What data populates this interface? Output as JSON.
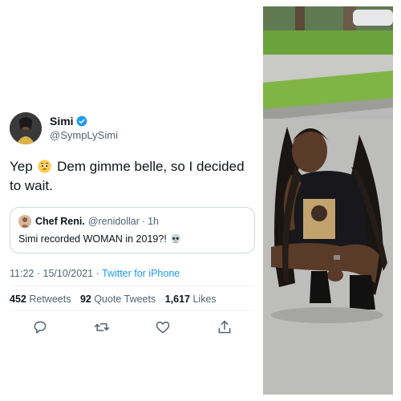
{
  "tweet": {
    "author": {
      "name": "Simi",
      "handle": "@SympLySimi",
      "verified": true
    },
    "text_before_emoji": "Yep",
    "text_after_emoji": "Dem gimme belle, so I decided to wait.",
    "emoji_icon": "face-with-pleading-eyes-icon",
    "quoted": {
      "name": "Chef Reni.",
      "handle": "@renidollar",
      "separator": "·",
      "time": "1h",
      "text": "Simi recorded WOMAN in 2019?!",
      "emoji_icon": "skull-icon"
    },
    "meta": {
      "time": "11:22",
      "separator1": "·",
      "date": "15/10/2021",
      "separator2": "·",
      "source": "Twitter for iPhone"
    },
    "stats": {
      "retweets_count": "452",
      "retweets_label": "Retweets",
      "quotes_count": "92",
      "quotes_label": "Quote Tweets",
      "likes_count": "1,617",
      "likes_label": "Likes"
    },
    "actions": [
      "reply-icon",
      "retweet-icon",
      "like-icon",
      "share-icon"
    ]
  },
  "colors": {
    "link_blue": "#1d9bf0",
    "secondary_text": "#536471",
    "primary_text": "#0f1419",
    "border": "#cfd9de"
  },
  "photo": {
    "subject": "woman with long braids crouching on a sidewalk"
  }
}
